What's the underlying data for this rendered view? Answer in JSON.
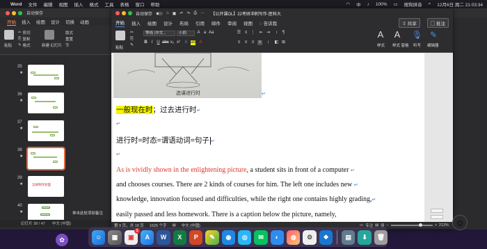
{
  "menubar": {
    "app": "Word",
    "items": [
      "文件",
      "编辑",
      "视图",
      "插入",
      "格式",
      "工具",
      "表格",
      "窗口",
      "帮助"
    ],
    "right_items": [
      "中",
      "100%",
      "搜狗拼音",
      "12月6日 周二 21:03:34"
    ]
  },
  "ppt": {
    "title": "自动保存",
    "tabs": [
      "开始",
      "插入",
      "绘图",
      "设计",
      "切换",
      "动画"
    ],
    "ribbon": {
      "paste": "粘贴",
      "cut": "剪切",
      "copy": "复制",
      "format": "格式",
      "new_slide": "新建\n幻灯片",
      "layout": "版式",
      "reset": "重置",
      "section": "节"
    },
    "slides": [
      {
        "num": "35",
        "star": "★"
      },
      {
        "num": "36",
        "star": "★"
      },
      {
        "num": "37",
        "star": "★"
      },
      {
        "num": "38",
        "star": "★"
      },
      {
        "num": "39",
        "star": "★",
        "text": "怎样制作封面"
      },
      {
        "num": "40",
        "star": "★"
      }
    ],
    "notes": "单击此处添加备注",
    "status_slide": "幻灯片 38 / 47",
    "status_lang": "中文 (中国)"
  },
  "word": {
    "autosave": "自动保存",
    "doc_title": "【公开课OL】22考研冲刺写作-医科大",
    "tabs": [
      "开始",
      "插入",
      "绘图",
      "设计",
      "布局",
      "引用",
      "邮件",
      "审阅",
      "视图"
    ],
    "tell_me": "告诉我",
    "share": "共享",
    "comments": "批注",
    "ribbon": {
      "paste": "粘贴",
      "font_name": "等线 (中文...",
      "font_size": "小四",
      "styles": "样式",
      "styles_pane": "样式\n窗格",
      "dictate": "听写",
      "editor": "编辑器"
    },
    "body": {
      "photo_caption": "选课进行时",
      "heading_highlight": "一般现在时",
      "heading_rest": "；过去进行时",
      "formula": "进行时=时态=谓语动词=句子",
      "eng_line1_red": "As is vividly shown in the enlightening picture",
      "eng_line1_rest": ", a student sits in front of a computer",
      "eng_line2": "and chooses courses. There are 2 kinds of courses for him. The left one includes new",
      "eng_line3": "knowledge, innovation focused and difficulties, while the right one contains highly grading,",
      "eng_line4": "easily passed and less homework. There is a caption below the picture, namely,",
      "return_mark": "↵"
    },
    "status": {
      "page": "第 9 页，共 18 页",
      "words": "1625 个字",
      "lang": "中文 (中国)",
      "focus": "专注",
      "zoom": "213%"
    }
  },
  "dock": {
    "badge": "1"
  },
  "colors": {
    "accent_ppt": "#e2683c",
    "word_blue": "#2b579a",
    "highlight": "#f5f500",
    "red_text": "#e0352b"
  }
}
